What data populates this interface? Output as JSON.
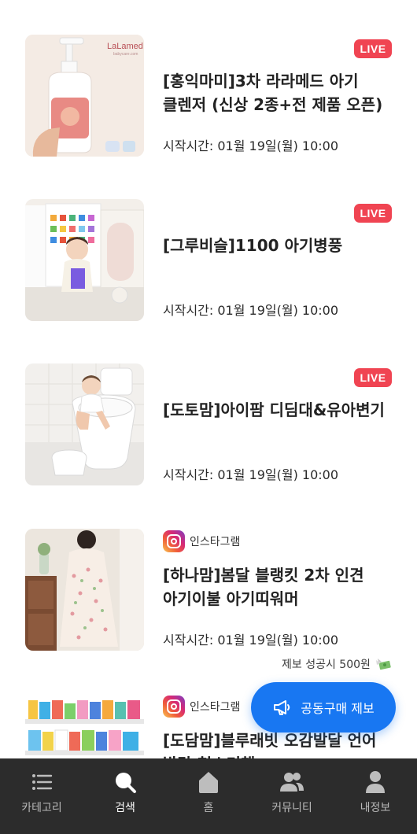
{
  "feed": {
    "items": [
      {
        "badge": "LIVE",
        "title": "[홍익마미]3차 라라메드 아기 클렌저 (신상 2종+전 제품 오픈)",
        "time": "시작시간: 01월 19일(월) 10:00",
        "thumb_brand": "LaLamed",
        "thumb_brand_sub": "babycare.com"
      },
      {
        "badge": "LIVE",
        "title": "[그루비슬]1100 아기병풍",
        "time": "시작시간: 01월 19일(월) 10:00"
      },
      {
        "badge": "LIVE",
        "title": "[도토맘]아이팜 디딤대&유아변기",
        "time": "시작시간: 01월 19일(월) 10:00"
      },
      {
        "source": "인스타그램",
        "source_icon": "instagram-icon",
        "title": "[하나맘]봄달 블랭킷 2차 인견 아기이불 아기띠워머",
        "time": "시작시간: 01월 19일(월) 10:00"
      },
      {
        "source": "인스타그램",
        "source_icon": "instagram-icon",
        "title": "[도담맘]블루래빗 오감발달 언어 발달 첫소리책",
        "time": ""
      }
    ]
  },
  "promo": {
    "note": "제보 성공시 500원",
    "note_icon": "money-with-wings-icon",
    "button_label": "공동구매 제보",
    "button_icon": "megaphone-icon",
    "button_color": "#1877f2"
  },
  "tabbar": {
    "active": "검색",
    "tabs": [
      {
        "label": "카테고리",
        "icon": "list-icon"
      },
      {
        "label": "검색",
        "icon": "search-icon"
      },
      {
        "label": "홈",
        "icon": "home-icon"
      },
      {
        "label": "커뮤니티",
        "icon": "people-icon"
      },
      {
        "label": "내정보",
        "icon": "person-icon"
      }
    ]
  },
  "colors": {
    "live_badge": "#f04452",
    "tabbar_bg": "#2c2c2c"
  }
}
